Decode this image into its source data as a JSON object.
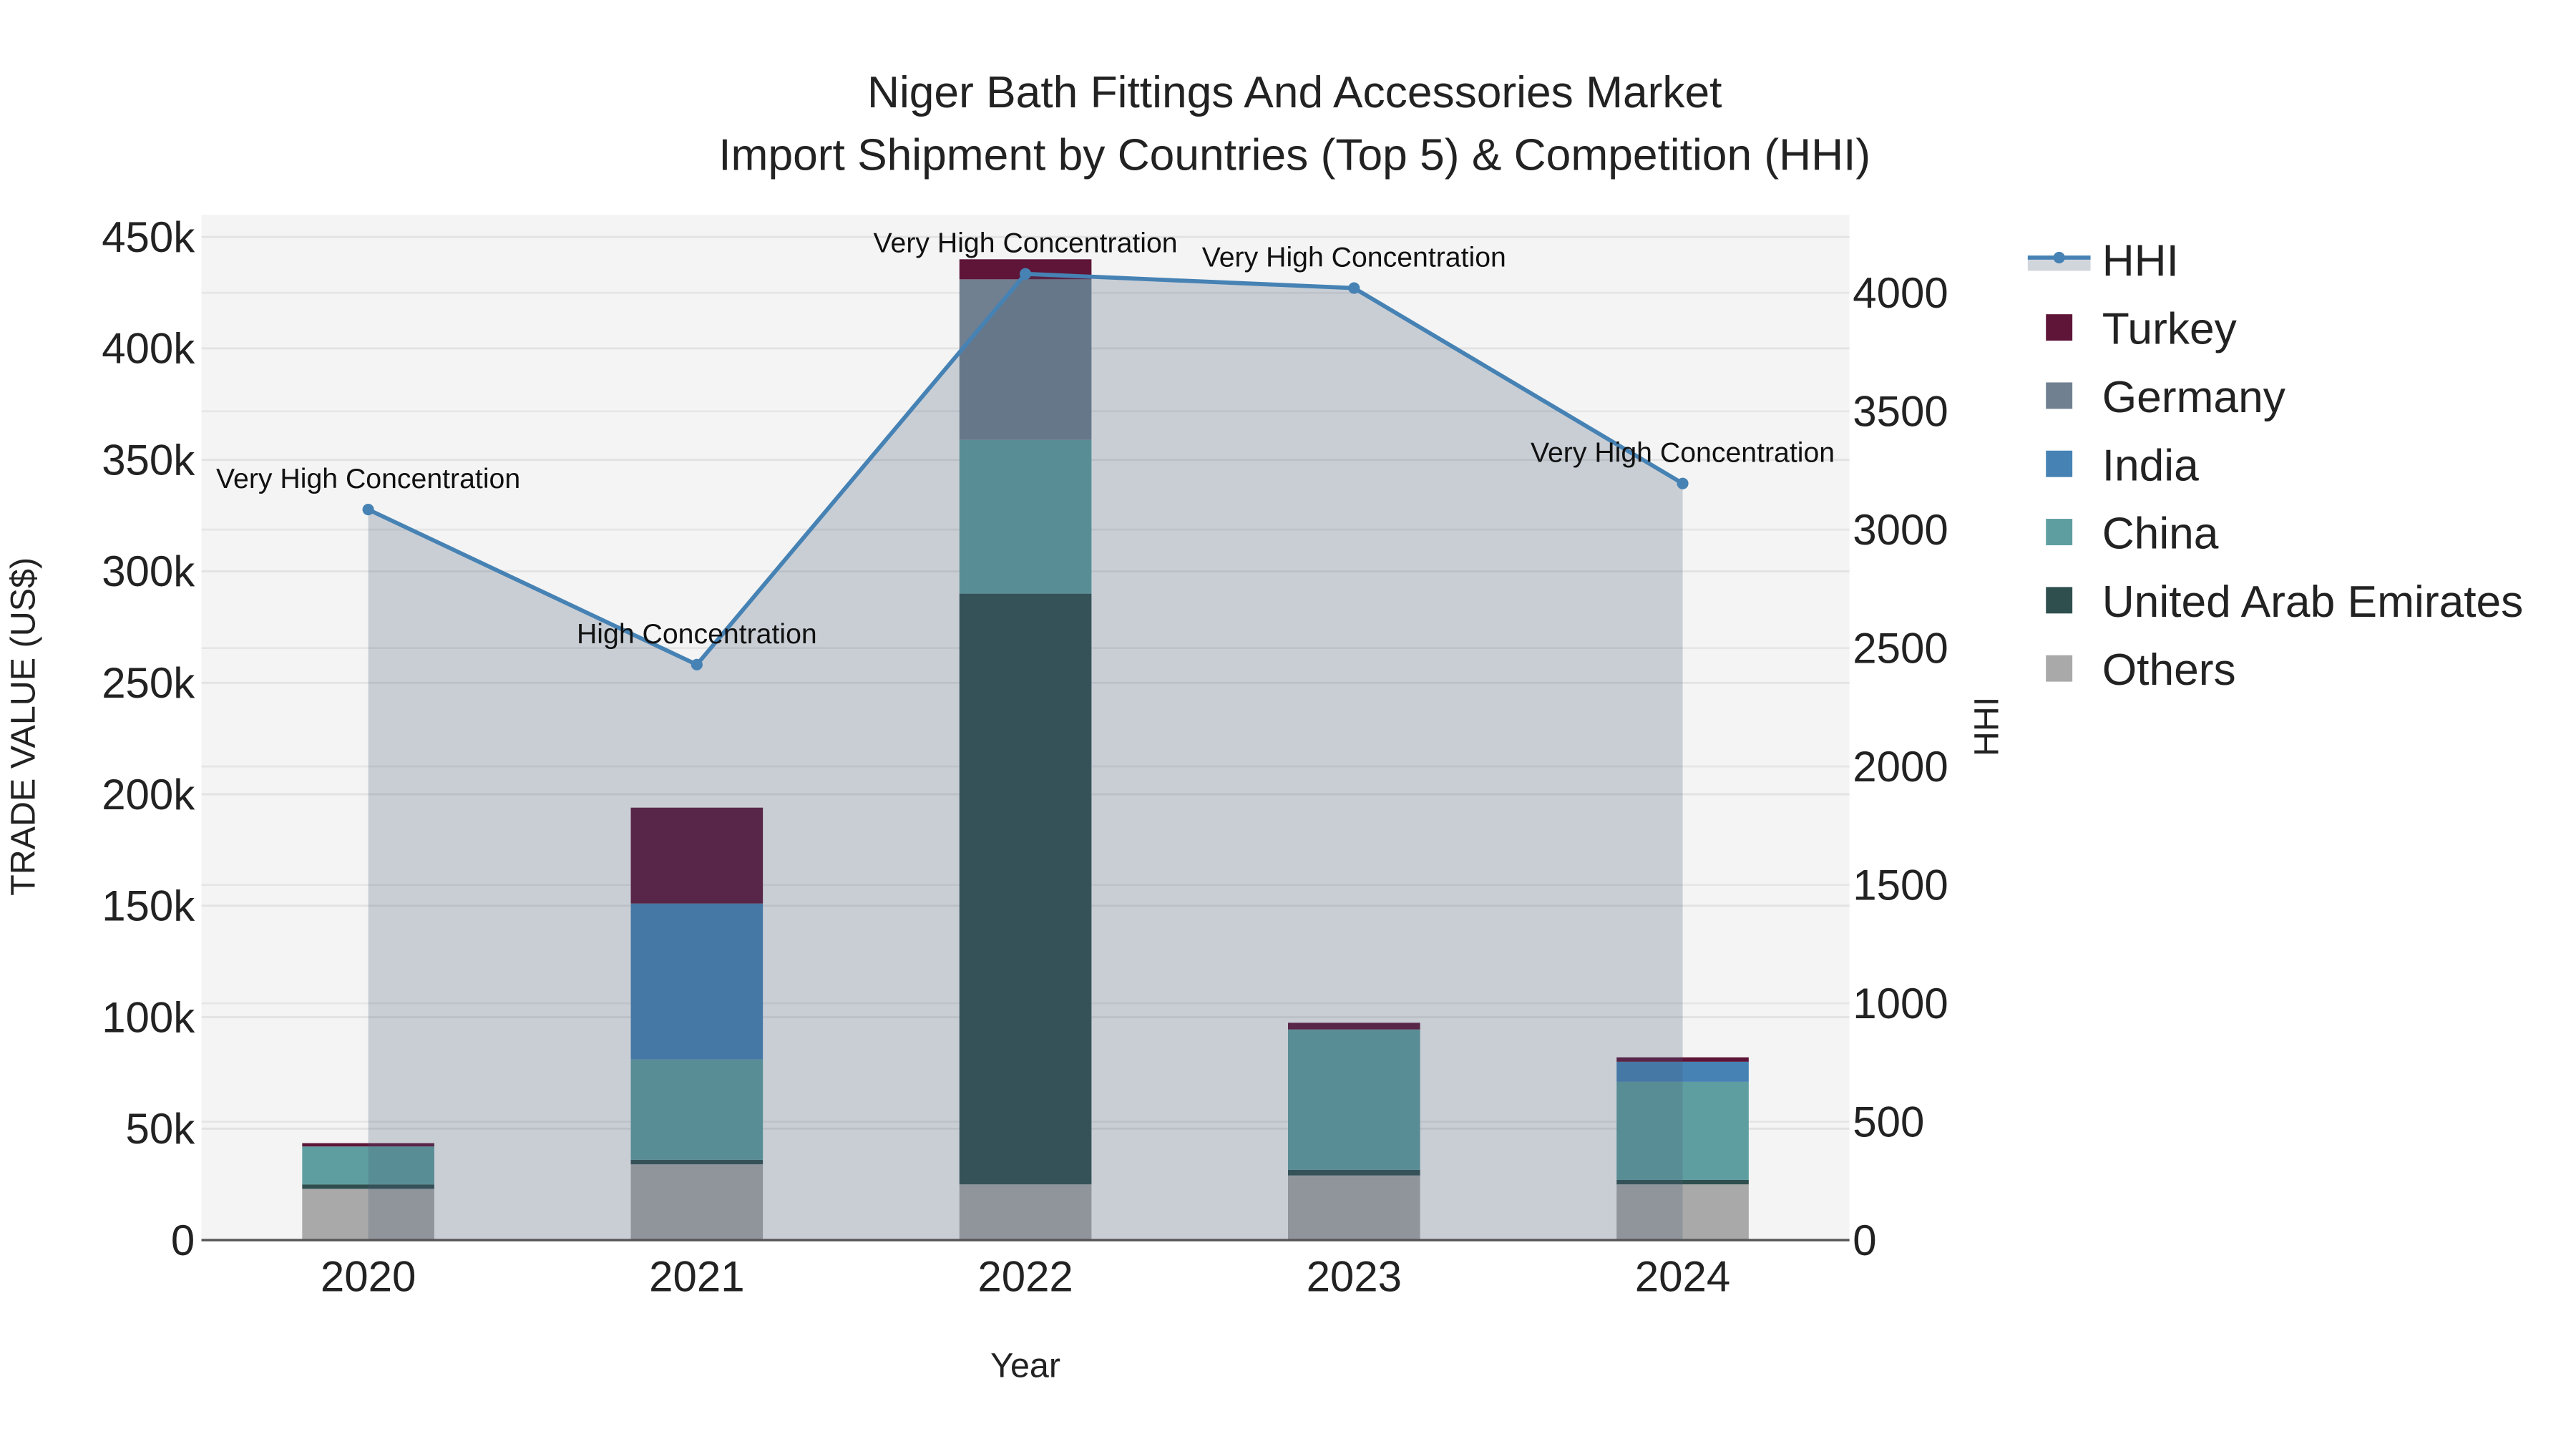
{
  "chart_data": {
    "type": "bar",
    "title_line1": "Niger Bath Fittings And Accessories Market",
    "title_line2": "Import Shipment by Countries (Top 5) & Competition (HHI)",
    "xlabel": "Year",
    "ylabel": "TRADE VALUE (US$)",
    "y2label": "HHI",
    "categories": [
      "2020",
      "2021",
      "2022",
      "2023",
      "2024"
    ],
    "ylim": [
      0,
      460000
    ],
    "y2lim": [
      0,
      4330
    ],
    "yticks": [
      0,
      50000,
      100000,
      150000,
      200000,
      250000,
      300000,
      350000,
      400000,
      450000
    ],
    "ytick_labels": [
      "0",
      "50k",
      "100k",
      "150k",
      "200k",
      "250k",
      "300k",
      "350k",
      "400k",
      "450k"
    ],
    "y2ticks": [
      0,
      500,
      1000,
      1500,
      2000,
      2500,
      3000,
      3500,
      4000
    ],
    "y2tick_labels": [
      "0",
      "500",
      "1000",
      "1500",
      "2000",
      "2500",
      "3000",
      "3500",
      "4000"
    ],
    "series": [
      {
        "name": "Others",
        "color": "#a9a9a9",
        "values": [
          23000,
          34000,
          25000,
          29000,
          25000
        ]
      },
      {
        "name": "United Arab Emirates",
        "color": "#2f4f4f",
        "values": [
          2000,
          2000,
          265000,
          2500,
          2000
        ]
      },
      {
        "name": "China",
        "color": "#5f9ea0",
        "values": [
          17000,
          45000,
          69000,
          63000,
          44000
        ]
      },
      {
        "name": "India",
        "color": "#4682b4",
        "values": [
          0,
          70000,
          0,
          0,
          9000
        ]
      },
      {
        "name": "Germany",
        "color": "#708090",
        "values": [
          0,
          0,
          72000,
          0,
          0
        ]
      },
      {
        "name": "Turkey",
        "color": "#5e1538",
        "values": [
          1500,
          43000,
          9000,
          3000,
          2000
        ]
      }
    ],
    "hhi": {
      "name": "HHI",
      "color": "#4682b4",
      "values": [
        3085,
        2430,
        4080,
        4020,
        3195
      ],
      "annotations": [
        "Very High Concentration",
        "High Concentration",
        "Very High Concentration",
        "Very High Concentration",
        "Very High Concentration"
      ]
    },
    "legend": [
      "HHI",
      "Turkey",
      "Germany",
      "India",
      "China",
      "United Arab Emirates",
      "Others"
    ],
    "legend_position": "right",
    "grid": true
  }
}
